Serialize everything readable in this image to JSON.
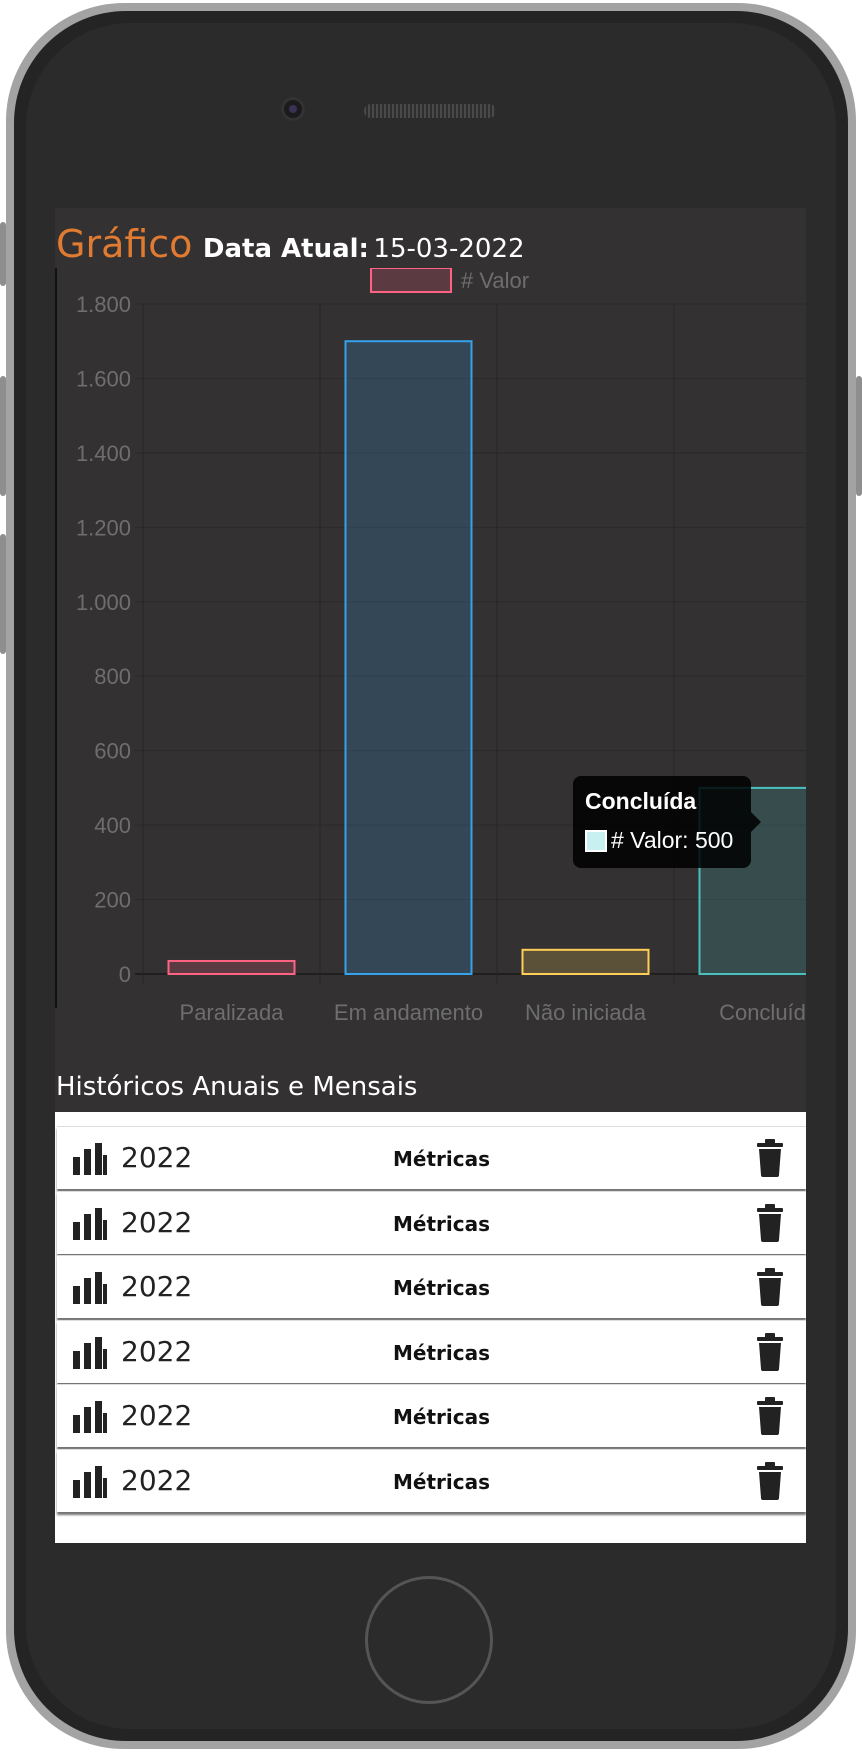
{
  "header": {
    "title": "Gráfico",
    "date_label": "Data Atual:",
    "date_value": "15-03-2022"
  },
  "chart_data": {
    "type": "bar",
    "categories": [
      "Paralizada",
      "Em andamento",
      "Não iniciada",
      "Concluída"
    ],
    "category_labels_visible": [
      "Paralizada",
      "Em andamento",
      "Não iniciada",
      "Concluíd"
    ],
    "series": [
      {
        "name": "# Valor",
        "values": [
          35,
          1700,
          65,
          500
        ]
      }
    ],
    "colors": {
      "border": [
        "#ff6384",
        "#36a2eb",
        "#ffce56",
        "#4bc0c0"
      ],
      "fill": [
        "rgba(255,99,132,0.2)",
        "rgba(54,162,235,0.2)",
        "rgba(255,206,86,0.2)",
        "rgba(75,192,192,0.2)"
      ]
    },
    "y_ticks": [
      "1.800",
      "1.600",
      "1.400",
      "1.200",
      "1.000",
      "800",
      "600",
      "400",
      "200",
      "0"
    ],
    "ylim": [
      0,
      1800
    ],
    "grid": true,
    "legend": "top-center",
    "title": "",
    "xlabel": "",
    "ylabel": ""
  },
  "tooltip": {
    "title": "Concluída",
    "text": "# Valor: 500"
  },
  "history": {
    "title": "Históricos Anuais e Mensais",
    "items": [
      {
        "year": "2022",
        "label": "Métricas"
      },
      {
        "year": "2022",
        "label": "Métricas"
      },
      {
        "year": "2022",
        "label": "Métricas"
      },
      {
        "year": "2022",
        "label": "Métricas"
      },
      {
        "year": "2022",
        "label": "Métricas"
      },
      {
        "year": "2022",
        "label": "Métricas"
      }
    ],
    "icons": {
      "left": "bar-chart-icon",
      "right": "trash-icon"
    }
  }
}
